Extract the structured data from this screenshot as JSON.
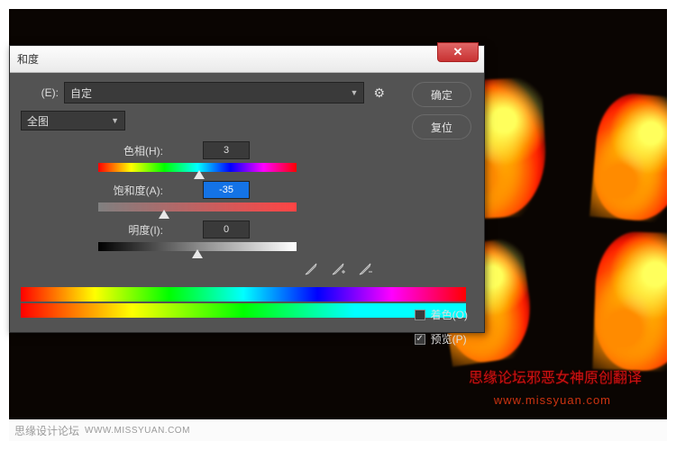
{
  "dialog": {
    "title": "和度",
    "preset_label": "(E):",
    "preset_value": "自定",
    "channel_value": "全图",
    "ok_label": "确定",
    "reset_label": "复位",
    "hue": {
      "label": "色相(H):",
      "value": "3",
      "thumb_pct": 51
    },
    "saturation": {
      "label": "饱和度(A):",
      "value": "-35",
      "thumb_pct": 33
    },
    "lightness": {
      "label": "明度(I):",
      "value": "0",
      "thumb_pct": 50
    },
    "colorize_label": "着色(O)",
    "preview_label": "预览(P)",
    "colorize_checked": false,
    "preview_checked": true
  },
  "watermark": {
    "cn": "思缘论坛邪恶女神原创翻译",
    "url": "www.missyuan.com"
  },
  "footer": {
    "site": "思缘设计论坛",
    "url": "WWW.MISSYUAN.COM"
  }
}
